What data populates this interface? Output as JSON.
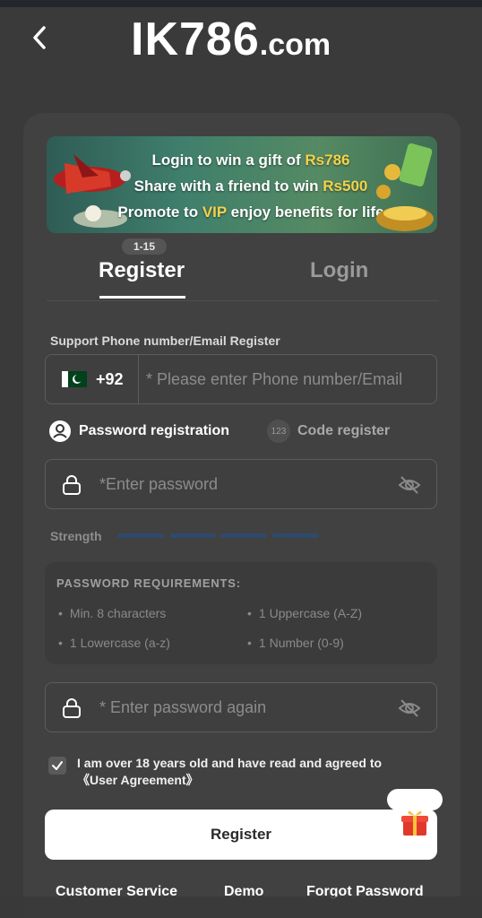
{
  "header": {
    "brand_big": "IK786",
    "brand_small": ".com"
  },
  "banner": {
    "line1_prefix": "Login to win a gift of ",
    "line1_highlight": "Rs786",
    "line2_prefix": "Share with a friend to win ",
    "line2_highlight": "Rs500",
    "line3_prefix": "Promote to ",
    "line3_highlight": "VIP",
    "line3_suffix": " enjoy benefits for life"
  },
  "tabs": {
    "badge": "1-15",
    "register": "Register",
    "login": "Login"
  },
  "phone": {
    "label": "Support Phone number/Email Register",
    "country_code": "+92",
    "placeholder": "* Please enter Phone number/Email"
  },
  "reg_options": {
    "password": "Password registration",
    "code_icon": "123",
    "code": "Code register"
  },
  "password": {
    "placeholder": "*Enter password",
    "strength_label": "Strength"
  },
  "requirements": {
    "title": "PASSWORD REQUIREMENTS:",
    "items": [
      "Min. 8 characters",
      "1 Uppercase (A-Z)",
      "1 Lowercase (a-z)",
      "1 Number (0-9)"
    ]
  },
  "confirm": {
    "placeholder": "* Enter password again"
  },
  "agreement": {
    "text": "I am over 18 years old and have read and agreed to",
    "link": "《User Agreement》",
    "checked": true
  },
  "register_button": "Register",
  "footer": {
    "customer_service": "Customer Service",
    "demo": "Demo",
    "forgot": "Forgot Password"
  },
  "colors": {
    "background": "#3a3a3a",
    "card": "#414141",
    "highlight": "#f4d24b",
    "strength_bar": "#2f4a6b"
  }
}
